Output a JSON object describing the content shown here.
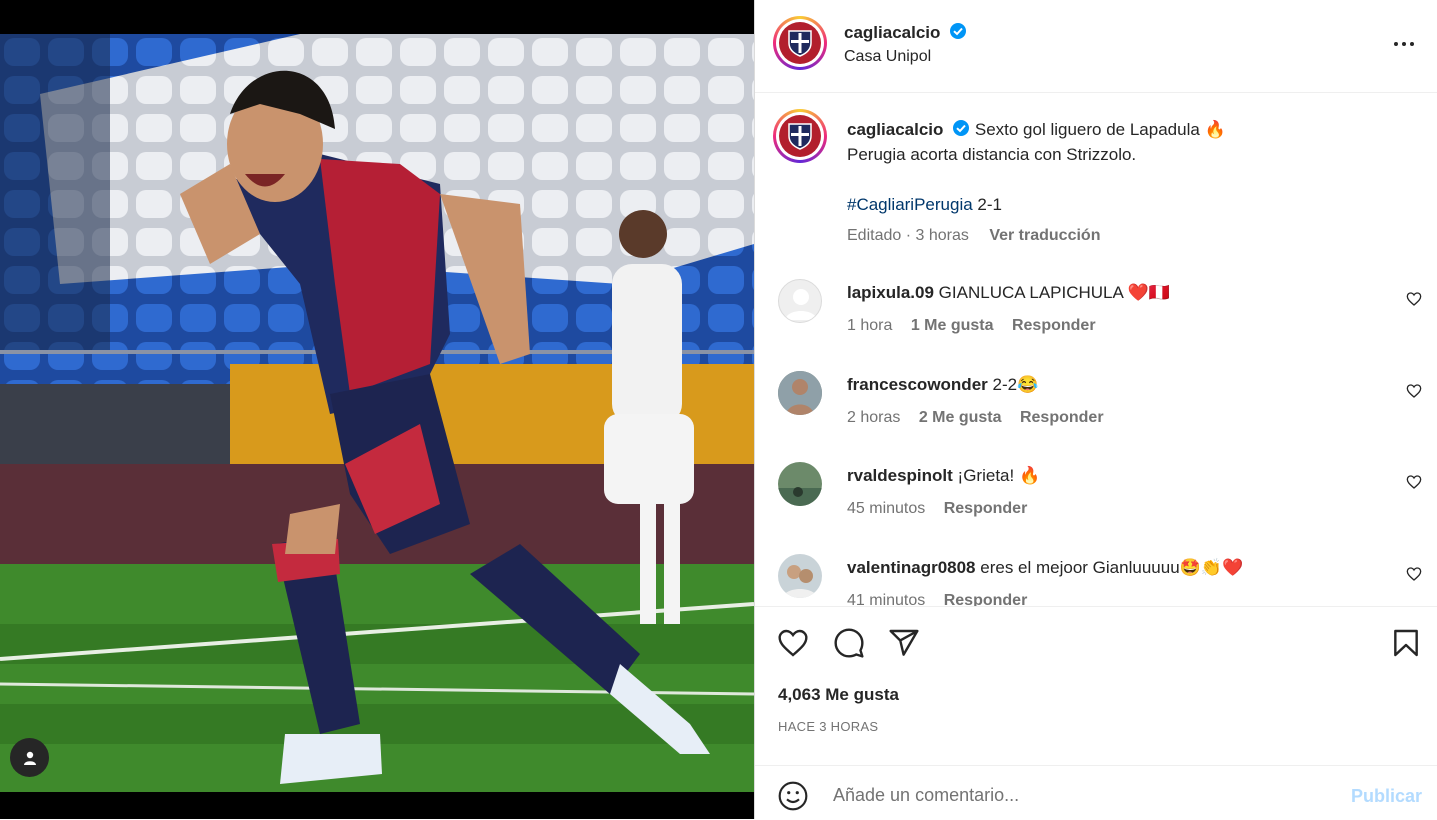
{
  "post": {
    "username": "cagliacalcio",
    "location": "Casa Unipol",
    "caption_text": "Sexto gol liguero de Lapadula 🔥",
    "caption_line2": "Perugia acorta distancia con Strizzolo.",
    "hashtag": "#CagliariPerugia",
    "score": " 2-1",
    "edited": "Editado · 3 horas",
    "translate": "Ver traducción",
    "likes": "4,063 Me gusta",
    "time": "HACE 3 HORAS"
  },
  "comments": [
    {
      "user": "lapixula.09",
      "text": "GIANLUCA LAPICHULA ❤️🇵🇪",
      "time": "1 hora",
      "likes": "1 Me gusta",
      "reply": "Responder"
    },
    {
      "user": "francescowonder",
      "text": "2-2😂",
      "time": "2 horas",
      "likes": "2 Me gusta",
      "reply": "Responder"
    },
    {
      "user": "rvaldespinolt",
      "text": "¡Grieta! 🔥",
      "time": "45 minutos",
      "likes": "",
      "reply": "Responder"
    },
    {
      "user": "valentinagr0808",
      "text": "eres el mejoor Gianluuuuu🤩👏❤️",
      "time": "41 minutos",
      "likes": "",
      "reply": "Responder"
    }
  ],
  "add_comment": {
    "placeholder": "Añade un comentario...",
    "publish": "Publicar"
  },
  "colors": {
    "accent": "#0095f6",
    "publish_disabled": "#b3dbff",
    "muted": "#737373"
  },
  "icons": [
    "user-tag-icon",
    "more-icon",
    "heart-icon",
    "comment-icon",
    "share-icon",
    "save-icon",
    "emoji-icon",
    "verified-icon"
  ]
}
